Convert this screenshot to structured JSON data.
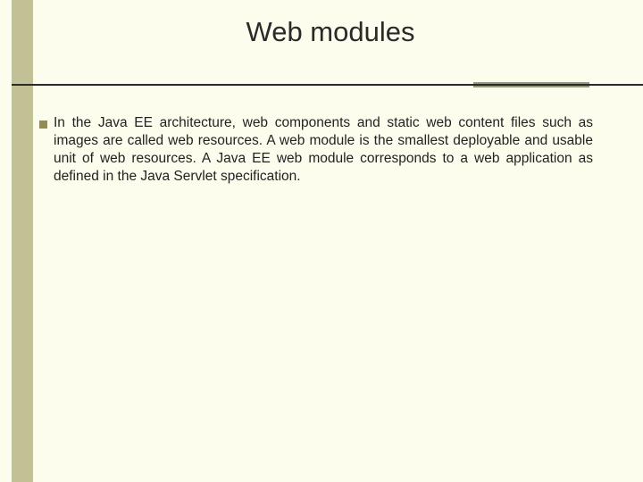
{
  "title": "Web modules",
  "body": "In the Java EE architecture, web components and static web content files such as images are called web resources. A web module is the smallest deployable and usable unit of web resources. A Java EE web module corresponds to a web application as defined in the Java Servlet specification."
}
